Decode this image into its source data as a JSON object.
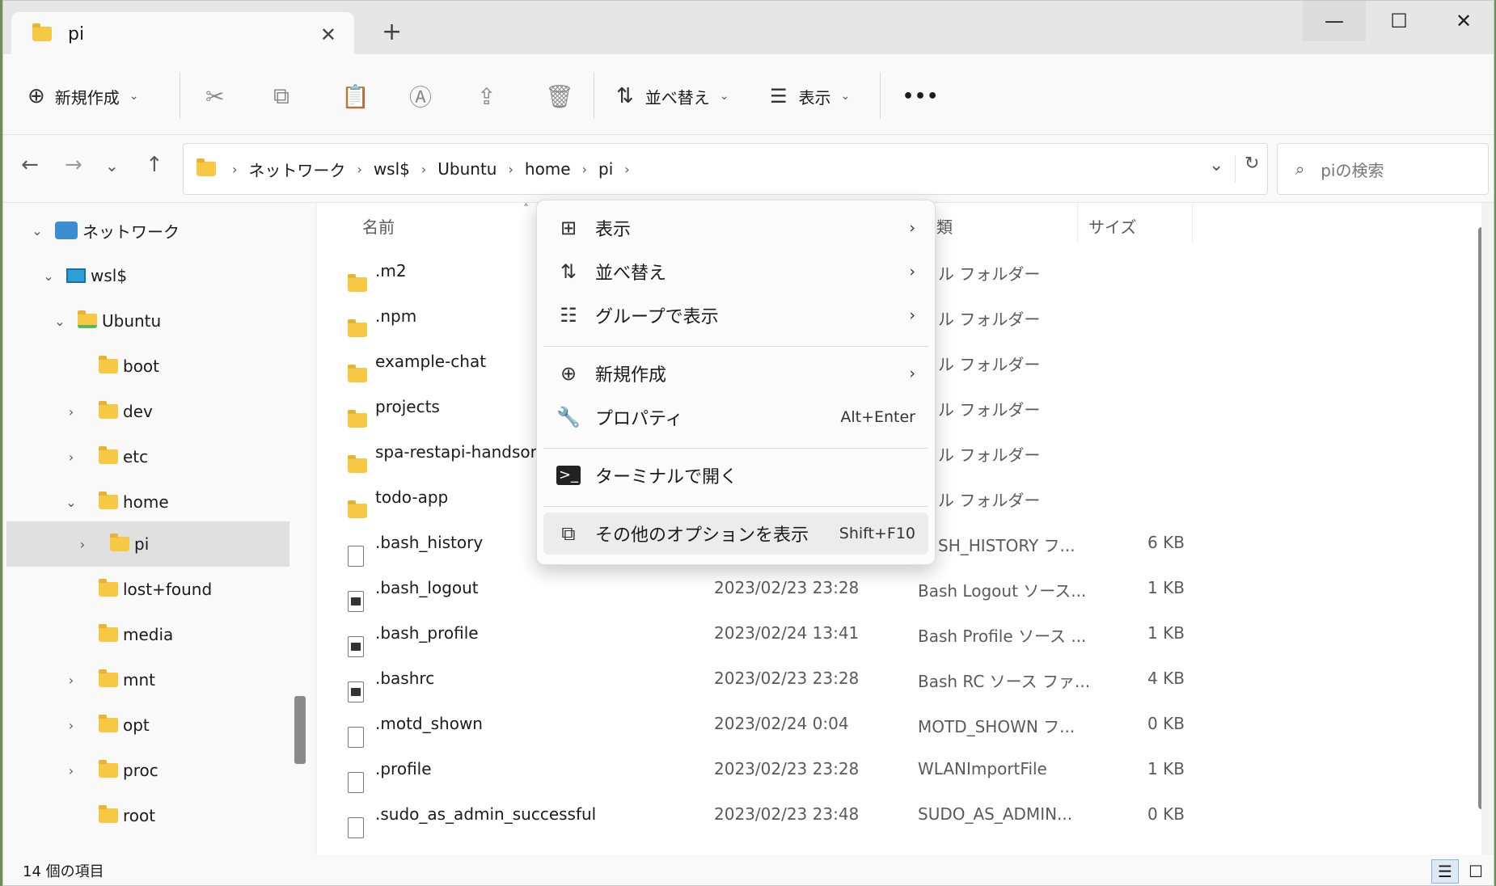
{
  "tab": {
    "title": "pi",
    "close": "✕",
    "add": "+"
  },
  "window_controls": {
    "minimize": "—",
    "maximize": "☐",
    "close": "✕"
  },
  "toolbar": {
    "new_label": "新規作成",
    "sort_label": "並べ替え",
    "view_label": "表示",
    "more": "•••"
  },
  "address": {
    "crumbs": [
      "ネットワーク",
      "wsl$",
      "Ubuntu",
      "home",
      "pi"
    ],
    "search_placeholder": "piの検索"
  },
  "sidebar": {
    "items": [
      {
        "label": "ネットワーク"
      },
      {
        "label": "wsl$"
      },
      {
        "label": "Ubuntu"
      },
      {
        "label": "boot"
      },
      {
        "label": "dev"
      },
      {
        "label": "etc"
      },
      {
        "label": "home"
      },
      {
        "label": "pi"
      },
      {
        "label": "lost+found"
      },
      {
        "label": "media"
      },
      {
        "label": "mnt"
      },
      {
        "label": "opt"
      },
      {
        "label": "proc"
      },
      {
        "label": "root"
      }
    ]
  },
  "columns": {
    "name": "名前",
    "type": "類",
    "size": "サイズ"
  },
  "files": [
    {
      "name": ".m2",
      "date": "",
      "type": "イル フォルダー",
      "size": ""
    },
    {
      "name": ".npm",
      "date": "",
      "type": "イル フォルダー",
      "size": ""
    },
    {
      "name": "example-chat",
      "date": "",
      "type": "イル フォルダー",
      "size": ""
    },
    {
      "name": "projects",
      "date": "",
      "type": "イル フォルダー",
      "size": ""
    },
    {
      "name": "spa-restapi-handson",
      "date": "",
      "type": "イル フォルダー",
      "size": ""
    },
    {
      "name": "todo-app",
      "date": "",
      "type": "イル フォルダー",
      "size": ""
    },
    {
      "name": ".bash_history",
      "date": "",
      "type": "SH_HISTORY フ...",
      "size": "6 KB"
    },
    {
      "name": ".bash_logout",
      "date": "2023/02/23 23:28",
      "type": "Bash Logout ソース...",
      "size": "1 KB"
    },
    {
      "name": ".bash_profile",
      "date": "2023/02/24 13:41",
      "type": "Bash Profile ソース ...",
      "size": "1 KB"
    },
    {
      "name": ".bashrc",
      "date": "2023/02/23 23:28",
      "type": "Bash RC ソース ファ...",
      "size": "4 KB"
    },
    {
      "name": ".motd_shown",
      "date": "2023/02/24 0:04",
      "type": "MOTD_SHOWN フ...",
      "size": "0 KB"
    },
    {
      "name": ".profile",
      "date": "2023/02/23 23:28",
      "type": "WLANImportFile",
      "size": "1 KB"
    },
    {
      "name": ".sudo_as_admin_successful",
      "date": "2023/02/23 23:48",
      "type": "SUDO_AS_ADMIN...",
      "size": "0 KB"
    }
  ],
  "context_menu": {
    "view": "表示",
    "sort": "並べ替え",
    "group": "グループで表示",
    "new": "新規作成",
    "properties": "プロパティ",
    "properties_shortcut": "Alt+Enter",
    "terminal": "ターミナルで開く",
    "more_options": "その他のオプションを表示",
    "more_options_shortcut": "Shift+F10"
  },
  "status": {
    "count": "14 個の項目"
  }
}
